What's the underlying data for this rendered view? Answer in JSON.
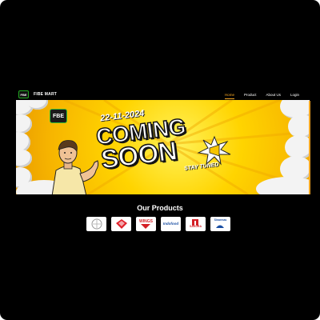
{
  "navbar": {
    "logo_text": "FBE",
    "brand": "FIBE MART",
    "links": [
      {
        "label": "Home",
        "active": true
      },
      {
        "label": "Product",
        "active": false
      },
      {
        "label": "About Us",
        "active": false
      },
      {
        "label": "Login",
        "active": false
      }
    ]
  },
  "banner": {
    "logo_text": "FBE",
    "date": "22-11-2024",
    "headline_1": "COMING",
    "headline_2": "SOON",
    "tagline": "STAY TUNED"
  },
  "products": {
    "title": "Our Products",
    "brands": [
      {
        "name": "",
        "icon": "grey-emblem-logo"
      },
      {
        "name": "",
        "icon": "red-diamond-logo"
      },
      {
        "name": "WINGS",
        "icon": "wings-logo"
      },
      {
        "name": "Indofood",
        "icon": "indofood-logo"
      },
      {
        "name": "SAKURA",
        "icon": "sakura-logo"
      },
      {
        "name": "Sinarmas",
        "icon": "sinarmas-logo"
      }
    ]
  },
  "colors": {
    "accent": "#f5a623",
    "background": "#000000",
    "banner_yellow": "#ffd400"
  }
}
